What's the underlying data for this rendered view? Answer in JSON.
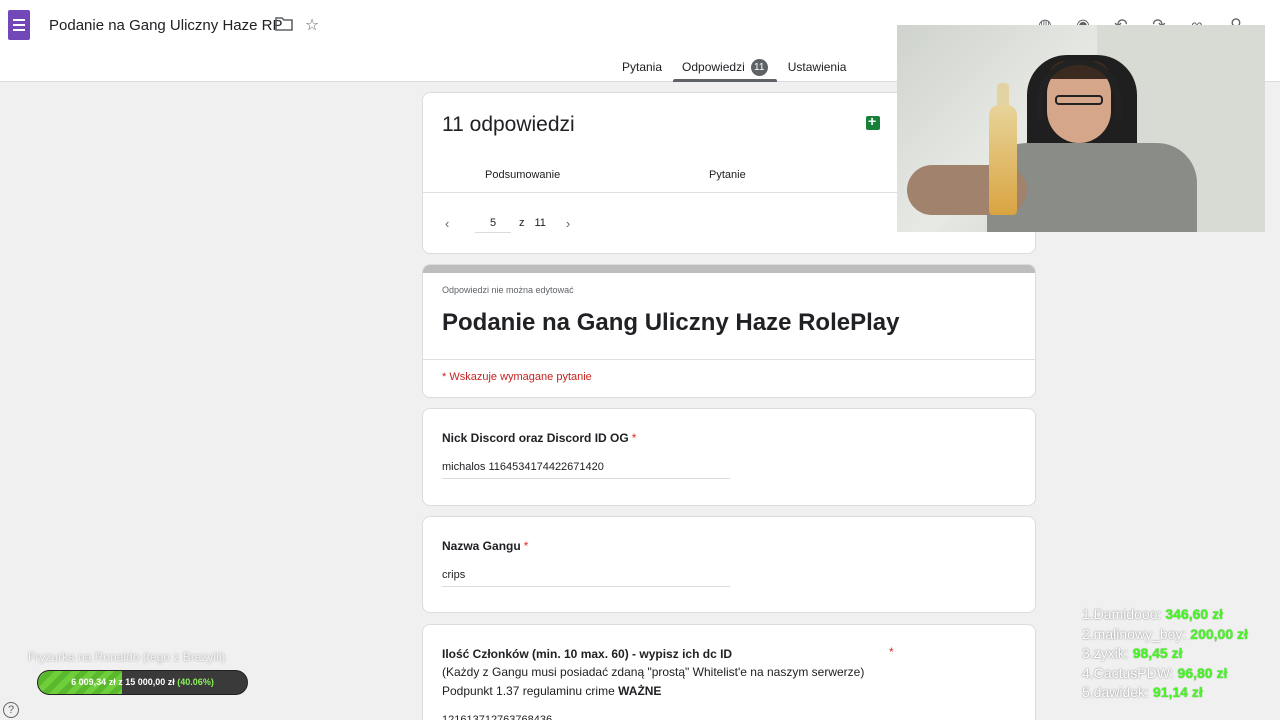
{
  "header": {
    "doc_title": "Podanie na Gang Uliczny Haze RP",
    "icons": [
      "forms-app-icon",
      "folder-icon",
      "star-icon",
      "palette-icon",
      "eye-icon",
      "undo-icon",
      "redo-icon",
      "link-icon",
      "add-person-icon"
    ]
  },
  "tabs": [
    {
      "label": "Pytania"
    },
    {
      "label": "Odpowiedzi",
      "badge": "11"
    },
    {
      "label": "Ustawienia"
    }
  ],
  "responses": {
    "count_label": "11 odpowiedzi",
    "subtabs": [
      "Podsumowanie",
      "Pytanie"
    ],
    "pager": {
      "current": "5",
      "of": "z",
      "total": "11"
    }
  },
  "form": {
    "note": "Odpowiedzi nie można edytować",
    "title": "Podanie na Gang Uliczny Haze RolePlay",
    "required_note": "* Wskazuje wymagane pytanie"
  },
  "questions": [
    {
      "label": "Nick Discord oraz Discord ID OG",
      "star": "*",
      "answer": "michalos 1164534174422671420"
    },
    {
      "label": "Nazwa Gangu",
      "star": "*",
      "answer": "crips"
    },
    {
      "label": "Ilość Członków (min. 10 max. 60) - wypisz ich dc ID",
      "star": "*",
      "desc1": "(Każdy z Gangu musi posiadać zdaną \"prostą\" Whitelist'e na naszym serwerze)",
      "desc2": "Podpunkt 1.37 regulaminu crime",
      "desc2_bold": "WAŻNE",
      "answer": "121613712763768436"
    }
  ],
  "goal": {
    "title": "Fryzurka na Ronaldo (tego z Brazylii)",
    "current": "6 009,34 zł",
    "separator": "z",
    "target": "15 000,00 zł",
    "percent_label": "(40.06%)",
    "fraction": 0.4006
  },
  "leaderboard": [
    {
      "name": "1.Damidooo:",
      "amount": "346,60 zł"
    },
    {
      "name": "2.malinowy_boy:",
      "amount": "200,00 zł"
    },
    {
      "name": "3.zyxik:",
      "amount": "98,45 zł"
    },
    {
      "name": "4.CactusPDW:",
      "amount": "96,80 zł"
    },
    {
      "name": "5.dawidek:",
      "amount": "91,14 zł"
    }
  ],
  "colors": {
    "accent": "#7248b9",
    "required": "#d93025",
    "goal_green": "#6fcf3a",
    "leader_green": "#49f526"
  }
}
